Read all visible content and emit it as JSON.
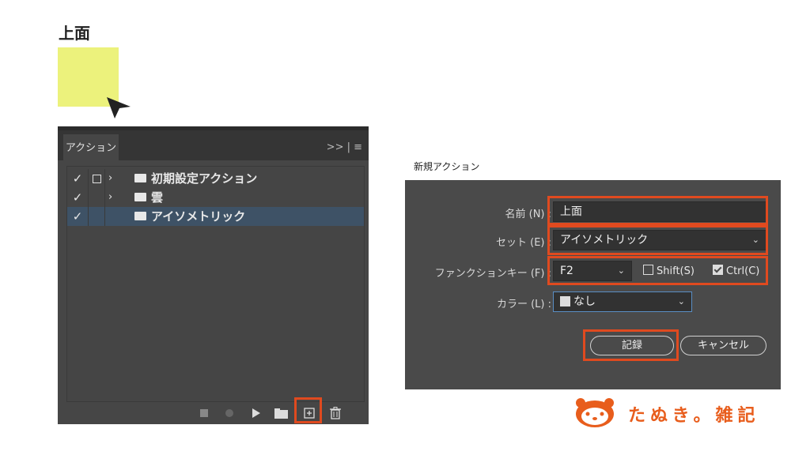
{
  "swatch": {
    "title": "上面",
    "color": "#ecf27c"
  },
  "actions_panel": {
    "tab_label": "アクション",
    "menu_glyph": ">> | ≡",
    "rows": [
      {
        "check": "✓",
        "label": "初期設定アクション",
        "expandable": true,
        "dialog_box": true
      },
      {
        "check": "✓",
        "label": "雲",
        "expandable": true,
        "dialog_box": false
      },
      {
        "check": "✓",
        "label": "アイソメトリック",
        "expandable": false,
        "dialog_box": false,
        "selected": true
      }
    ],
    "footer_icons": [
      "stop-icon",
      "record-icon",
      "play-icon",
      "folder-icon",
      "new-action-icon",
      "trash-icon"
    ]
  },
  "new_action_dialog": {
    "title": "新規アクション",
    "name_label": "名前 (N) :",
    "name_value": "上面",
    "set_label": "セット (E) :",
    "set_value": "アイソメトリック",
    "function_key_label": "ファンクションキー (F) :",
    "function_key_value": "F2",
    "shift_label": "Shift(S)",
    "shift_checked": false,
    "ctrl_label": "Ctrl(C)",
    "ctrl_checked": true,
    "color_label": "カラー (L) :",
    "color_value": "なし",
    "record_button": "記録",
    "cancel_button": "キャンセル"
  },
  "logo": {
    "text": "たぬき。雑記",
    "color": "#e85d1c"
  }
}
